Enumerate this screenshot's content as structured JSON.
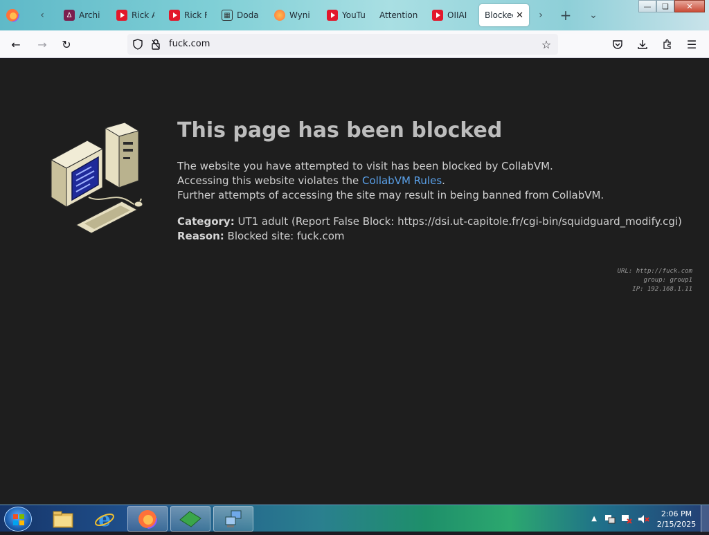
{
  "tabs": [
    {
      "label": "Archi",
      "icon": "archive-icon"
    },
    {
      "label": "Rick A",
      "icon": "youtube-icon"
    },
    {
      "label": "Rick R",
      "icon": "youtube-icon"
    },
    {
      "label": "Doda",
      "icon": "extension-icon"
    },
    {
      "label": "Wyni",
      "icon": "firefox-icon"
    },
    {
      "label": "YouTu",
      "icon": "youtube-icon"
    },
    {
      "label": "Attention",
      "icon": ""
    },
    {
      "label": "OIIAI",
      "icon": "youtube-icon"
    },
    {
      "label": "Blocked",
      "icon": "",
      "active": true
    }
  ],
  "navbar": {
    "url": "fuck.com"
  },
  "page": {
    "title": "This page has been blocked",
    "line1": "The website you have attempted to visit has been blocked by CollabVM.",
    "line2_prefix": "Accessing this website violates the ",
    "line2_link": "CollabVM Rules",
    "line2_suffix": ".",
    "line3": "Further attempts of accessing the site may result in being banned from CollabVM.",
    "category_label": "Category:",
    "category_value": " UT1 adult (Report False Block: https://dsi.ut-capitole.fr/cgi-bin/squidguard_modify.cgi)",
    "reason_label": "Reason:",
    "reason_value": " Blocked site: fuck.com",
    "meta_url": "URL: http://fuck.com",
    "meta_group": "group: group1",
    "meta_ip": "IP: 192.168.1.11"
  },
  "taskbar": {
    "time": "2:06 PM",
    "date": "2/15/2025"
  },
  "colors": {
    "page_bg": "#1e1e1e",
    "link": "#5aa0e8",
    "title": "#bdbdbd"
  }
}
